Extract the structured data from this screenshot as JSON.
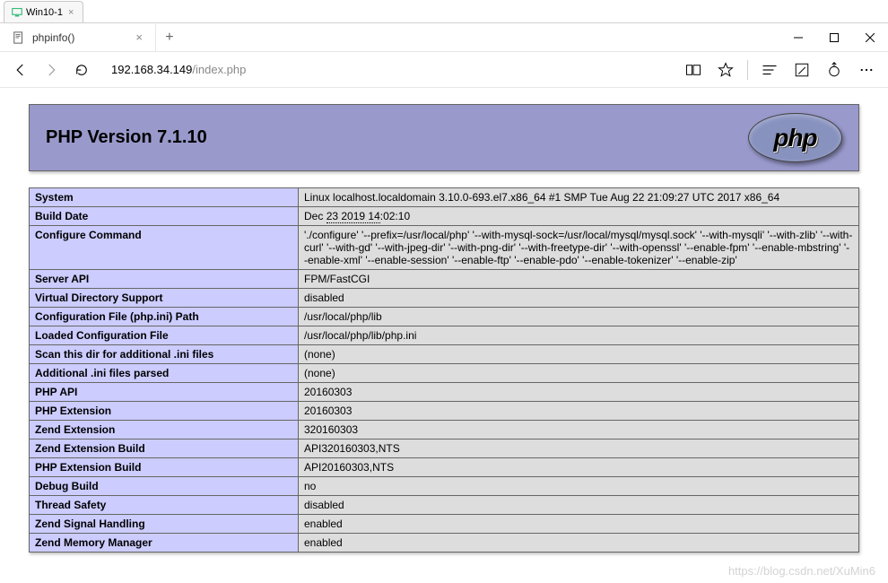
{
  "vm_tab": {
    "title": "Win10-1"
  },
  "browser": {
    "tab_title": "phpinfo()",
    "url_domain": "192.168.34.149",
    "url_path": "/index.php"
  },
  "header_title": "PHP Version 7.1.10",
  "logo_text": "php",
  "rows": {
    "system": {
      "label": "System",
      "value": "Linux localhost.localdomain 3.10.0-693.el7.x86_64 #1 SMP Tue Aug 22 21:09:27 UTC 2017 x86_64"
    },
    "build_date": {
      "label": "Build Date",
      "prefix": "Dec ",
      "underlined": "23 2019 14",
      "suffix": ":02:10"
    },
    "configure": {
      "label": "Configure Command",
      "value": "'./configure' '--prefix=/usr/local/php' '--with-mysql-sock=/usr/local/mysql/mysql.sock' '--with-mysqli' '--with-zlib' '--with-curl' '--with-gd' '--with-jpeg-dir' '--with-png-dir' '--with-freetype-dir' '--with-openssl' '--enable-fpm' '--enable-mbstring' '--enable-xml' '--enable-session' '--enable-ftp' '--enable-pdo' '--enable-tokenizer' '--enable-zip'"
    },
    "server_api": {
      "label": "Server API",
      "value": "FPM/FastCGI"
    },
    "virt_dir": {
      "label": "Virtual Directory Support",
      "value": "disabled"
    },
    "cfg_path": {
      "label": "Configuration File (php.ini) Path",
      "value": "/usr/local/php/lib"
    },
    "loaded_cfg": {
      "label": "Loaded Configuration File",
      "value": "/usr/local/php/lib/php.ini"
    },
    "scan_dir": {
      "label": "Scan this dir for additional .ini files",
      "value": "(none)"
    },
    "add_ini": {
      "label": "Additional .ini files parsed",
      "value": "(none)"
    },
    "php_api": {
      "label": "PHP API",
      "value": "20160303"
    },
    "php_ext": {
      "label": "PHP Extension",
      "value": "20160303"
    },
    "zend_ext": {
      "label": "Zend Extension",
      "value": "320160303"
    },
    "zend_ext_build": {
      "label": "Zend Extension Build",
      "value": "API320160303,NTS"
    },
    "php_ext_build": {
      "label": "PHP Extension Build",
      "value": "API20160303,NTS"
    },
    "debug_build": {
      "label": "Debug Build",
      "value": "no"
    },
    "thread_safety": {
      "label": "Thread Safety",
      "value": "disabled"
    },
    "zend_signal": {
      "label": "Zend Signal Handling",
      "value": "enabled"
    },
    "zend_mem": {
      "label": "Zend Memory Manager",
      "value": "enabled"
    }
  },
  "watermark": "https://blog.csdn.net/XuMin6"
}
